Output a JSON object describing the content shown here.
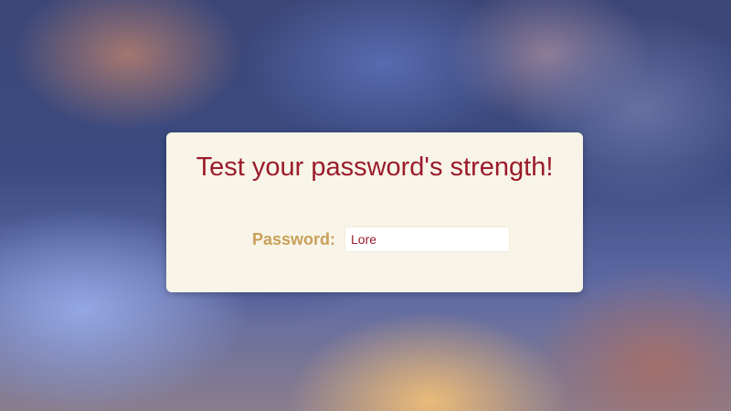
{
  "card": {
    "title": "Test your password's strength!",
    "password_label": "Password:",
    "password_value": "Lore"
  },
  "colors": {
    "title": "#9b1b2a",
    "label": "#c8a05a",
    "card_background": "#f8f5e8"
  }
}
